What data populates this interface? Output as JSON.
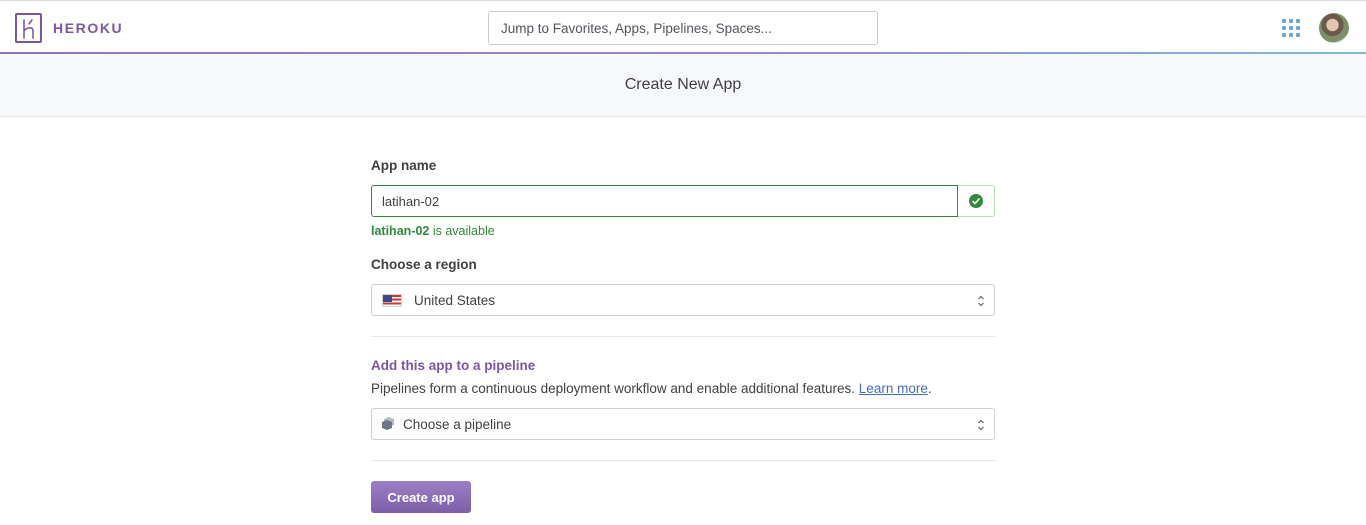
{
  "header": {
    "brand": "HEROKU",
    "search_placeholder": "Jump to Favorites, Apps, Pipelines, Spaces...",
    "apps_icon": "grid-icon",
    "avatar_icon": "user-avatar"
  },
  "page": {
    "title": "Create New App"
  },
  "form": {
    "app_name_label": "App name",
    "app_name_value": "latihan-02",
    "availability_name": "latihan-02",
    "availability_text": " is available",
    "region_label": "Choose a region",
    "region_value": "United States",
    "pipeline_title": "Add this app to a pipeline",
    "pipeline_desc": "Pipelines form a continuous deployment workflow and enable additional features. ",
    "learn_more": "Learn more",
    "learn_more_suffix": ".",
    "pipeline_value": "Choose a pipeline",
    "submit_label": "Create app"
  },
  "colors": {
    "brand": "#79589f",
    "success": "#2f8a3a",
    "link": "#3f6ec6"
  }
}
